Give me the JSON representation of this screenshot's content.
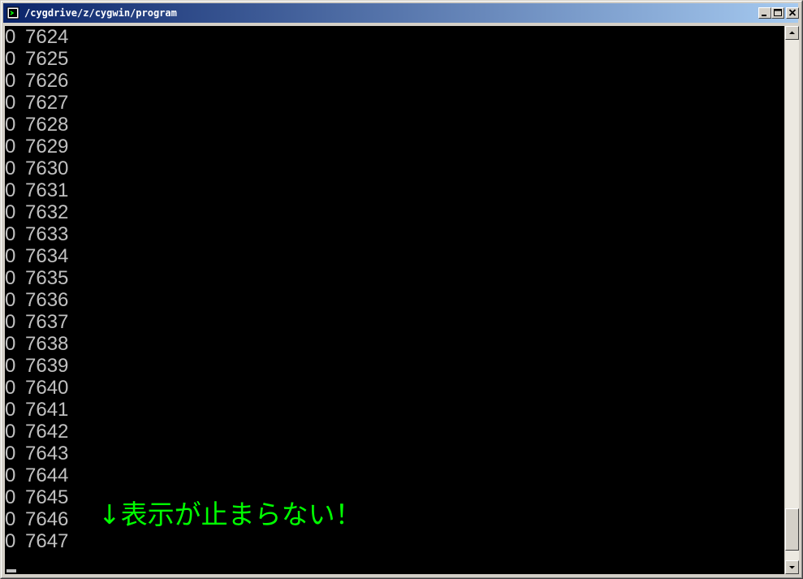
{
  "window": {
    "title": "/cygdrive/z/cygwin/program",
    "icon": "cygwin-terminal-icon",
    "title_gradient": [
      "#0a246a",
      "#a6caf0"
    ]
  },
  "console": {
    "background": "#000000",
    "text_color": "#c0c0c0",
    "lines": [
      {
        "a": "0",
        "b": "7624"
      },
      {
        "a": "0",
        "b": "7625"
      },
      {
        "a": "0",
        "b": "7626"
      },
      {
        "a": "0",
        "b": "7627"
      },
      {
        "a": "0",
        "b": "7628"
      },
      {
        "a": "0",
        "b": "7629"
      },
      {
        "a": "0",
        "b": "7630"
      },
      {
        "a": "0",
        "b": "7631"
      },
      {
        "a": "0",
        "b": "7632"
      },
      {
        "a": "0",
        "b": "7633"
      },
      {
        "a": "0",
        "b": "7634"
      },
      {
        "a": "0",
        "b": "7635"
      },
      {
        "a": "0",
        "b": "7636"
      },
      {
        "a": "0",
        "b": "7637"
      },
      {
        "a": "0",
        "b": "7638"
      },
      {
        "a": "0",
        "b": "7639"
      },
      {
        "a": "0",
        "b": "7640"
      },
      {
        "a": "0",
        "b": "7641"
      },
      {
        "a": "0",
        "b": "7642"
      },
      {
        "a": "0",
        "b": "7643"
      },
      {
        "a": "0",
        "b": "7644"
      },
      {
        "a": "0",
        "b": "7645"
      },
      {
        "a": "0",
        "b": "7646"
      },
      {
        "a": "0",
        "b": "7647"
      }
    ]
  },
  "annotation": {
    "text": "↓表示が止まらない！",
    "color": "#00ff00"
  },
  "scrollbar": {
    "position": 0.98
  }
}
